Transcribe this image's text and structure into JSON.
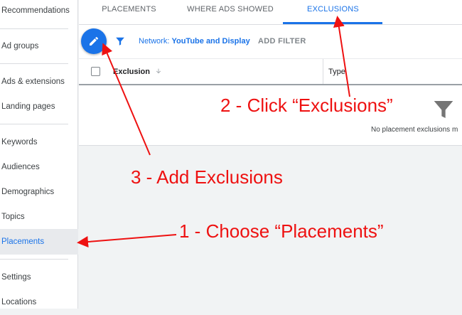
{
  "sidebar": {
    "items": [
      {
        "label": "Recommendations",
        "active": false
      },
      {
        "label": "Ad groups",
        "active": false
      },
      {
        "label": "Ads & extensions",
        "active": false
      },
      {
        "label": "Landing pages",
        "active": false
      },
      {
        "label": "Keywords",
        "active": false
      },
      {
        "label": "Audiences",
        "active": false
      },
      {
        "label": "Demographics",
        "active": false
      },
      {
        "label": "Topics",
        "active": false
      },
      {
        "label": "Placements",
        "active": true
      },
      {
        "label": "Settings",
        "active": false
      },
      {
        "label": "Locations",
        "active": false
      }
    ]
  },
  "tabs": [
    {
      "label": "PLACEMENTS",
      "active": false
    },
    {
      "label": "WHERE ADS SHOWED",
      "active": false
    },
    {
      "label": "EXCLUSIONS",
      "active": true
    }
  ],
  "toolbar": {
    "network_prefix": "Network: ",
    "network_value": "YouTube and Display",
    "add_filter": "ADD FILTER"
  },
  "table": {
    "columns": [
      "Exclusion",
      "Type"
    ],
    "empty_message": "No placement exclusions m"
  },
  "annotations": {
    "step1": "1 - Choose “Placements”",
    "step2": "2 - Click “Exclusions”",
    "step3": "3 - Add Exclusions"
  },
  "colors": {
    "accent": "#1a73e8",
    "annotation": "#ee1111"
  },
  "icons": [
    "pencil-icon",
    "filter-icon",
    "sort-arrow-down-icon"
  ]
}
